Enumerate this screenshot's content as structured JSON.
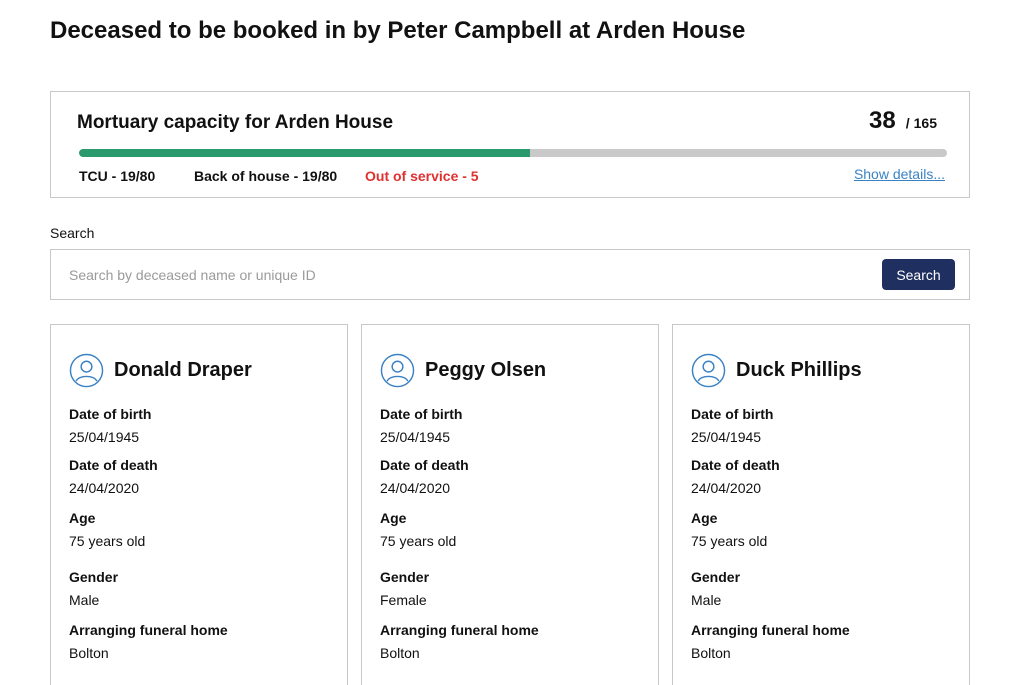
{
  "page": {
    "title": "Deceased to be booked in by Peter Campbell at Arden House"
  },
  "capacity": {
    "title": "Mortuary capacity for Arden House",
    "occupied": "38",
    "separator": "/",
    "total": "165",
    "progress_fraction": 0.52,
    "tcu": "TCU - 19/80",
    "back_of_house": "Back of house - 19/80",
    "out_of_service": "Out of service - 5",
    "show_details_label": "Show details...",
    "colors": {
      "progress_fill": "#2a9a6d",
      "out_of_service": "#e03131",
      "link": "#3b82c4"
    }
  },
  "search": {
    "label": "Search",
    "placeholder": "Search by deceased name or unique ID",
    "value": "",
    "button_label": "Search",
    "button_color": "#1f3060"
  },
  "field_labels": {
    "dob": "Date of birth",
    "dod": "Date of death",
    "age": "Age",
    "gender": "Gender",
    "funeral_home": "Arranging funeral home"
  },
  "cards": [
    {
      "icon": "user-avatar-icon",
      "name": "Donald Draper",
      "dob": "25/04/1945",
      "dod": "24/04/2020",
      "age": "75 years old",
      "gender": "Male",
      "funeral_home": "Bolton"
    },
    {
      "icon": "user-avatar-icon",
      "name": "Peggy Olsen",
      "dob": "25/04/1945",
      "dod": "24/04/2020",
      "age": "75 years old",
      "gender": "Female",
      "funeral_home": "Bolton"
    },
    {
      "icon": "user-avatar-icon",
      "name": "Duck Phillips",
      "dob": "25/04/1945",
      "dod": "24/04/2020",
      "age": "75 years old",
      "gender": "Male",
      "funeral_home": "Bolton"
    }
  ]
}
